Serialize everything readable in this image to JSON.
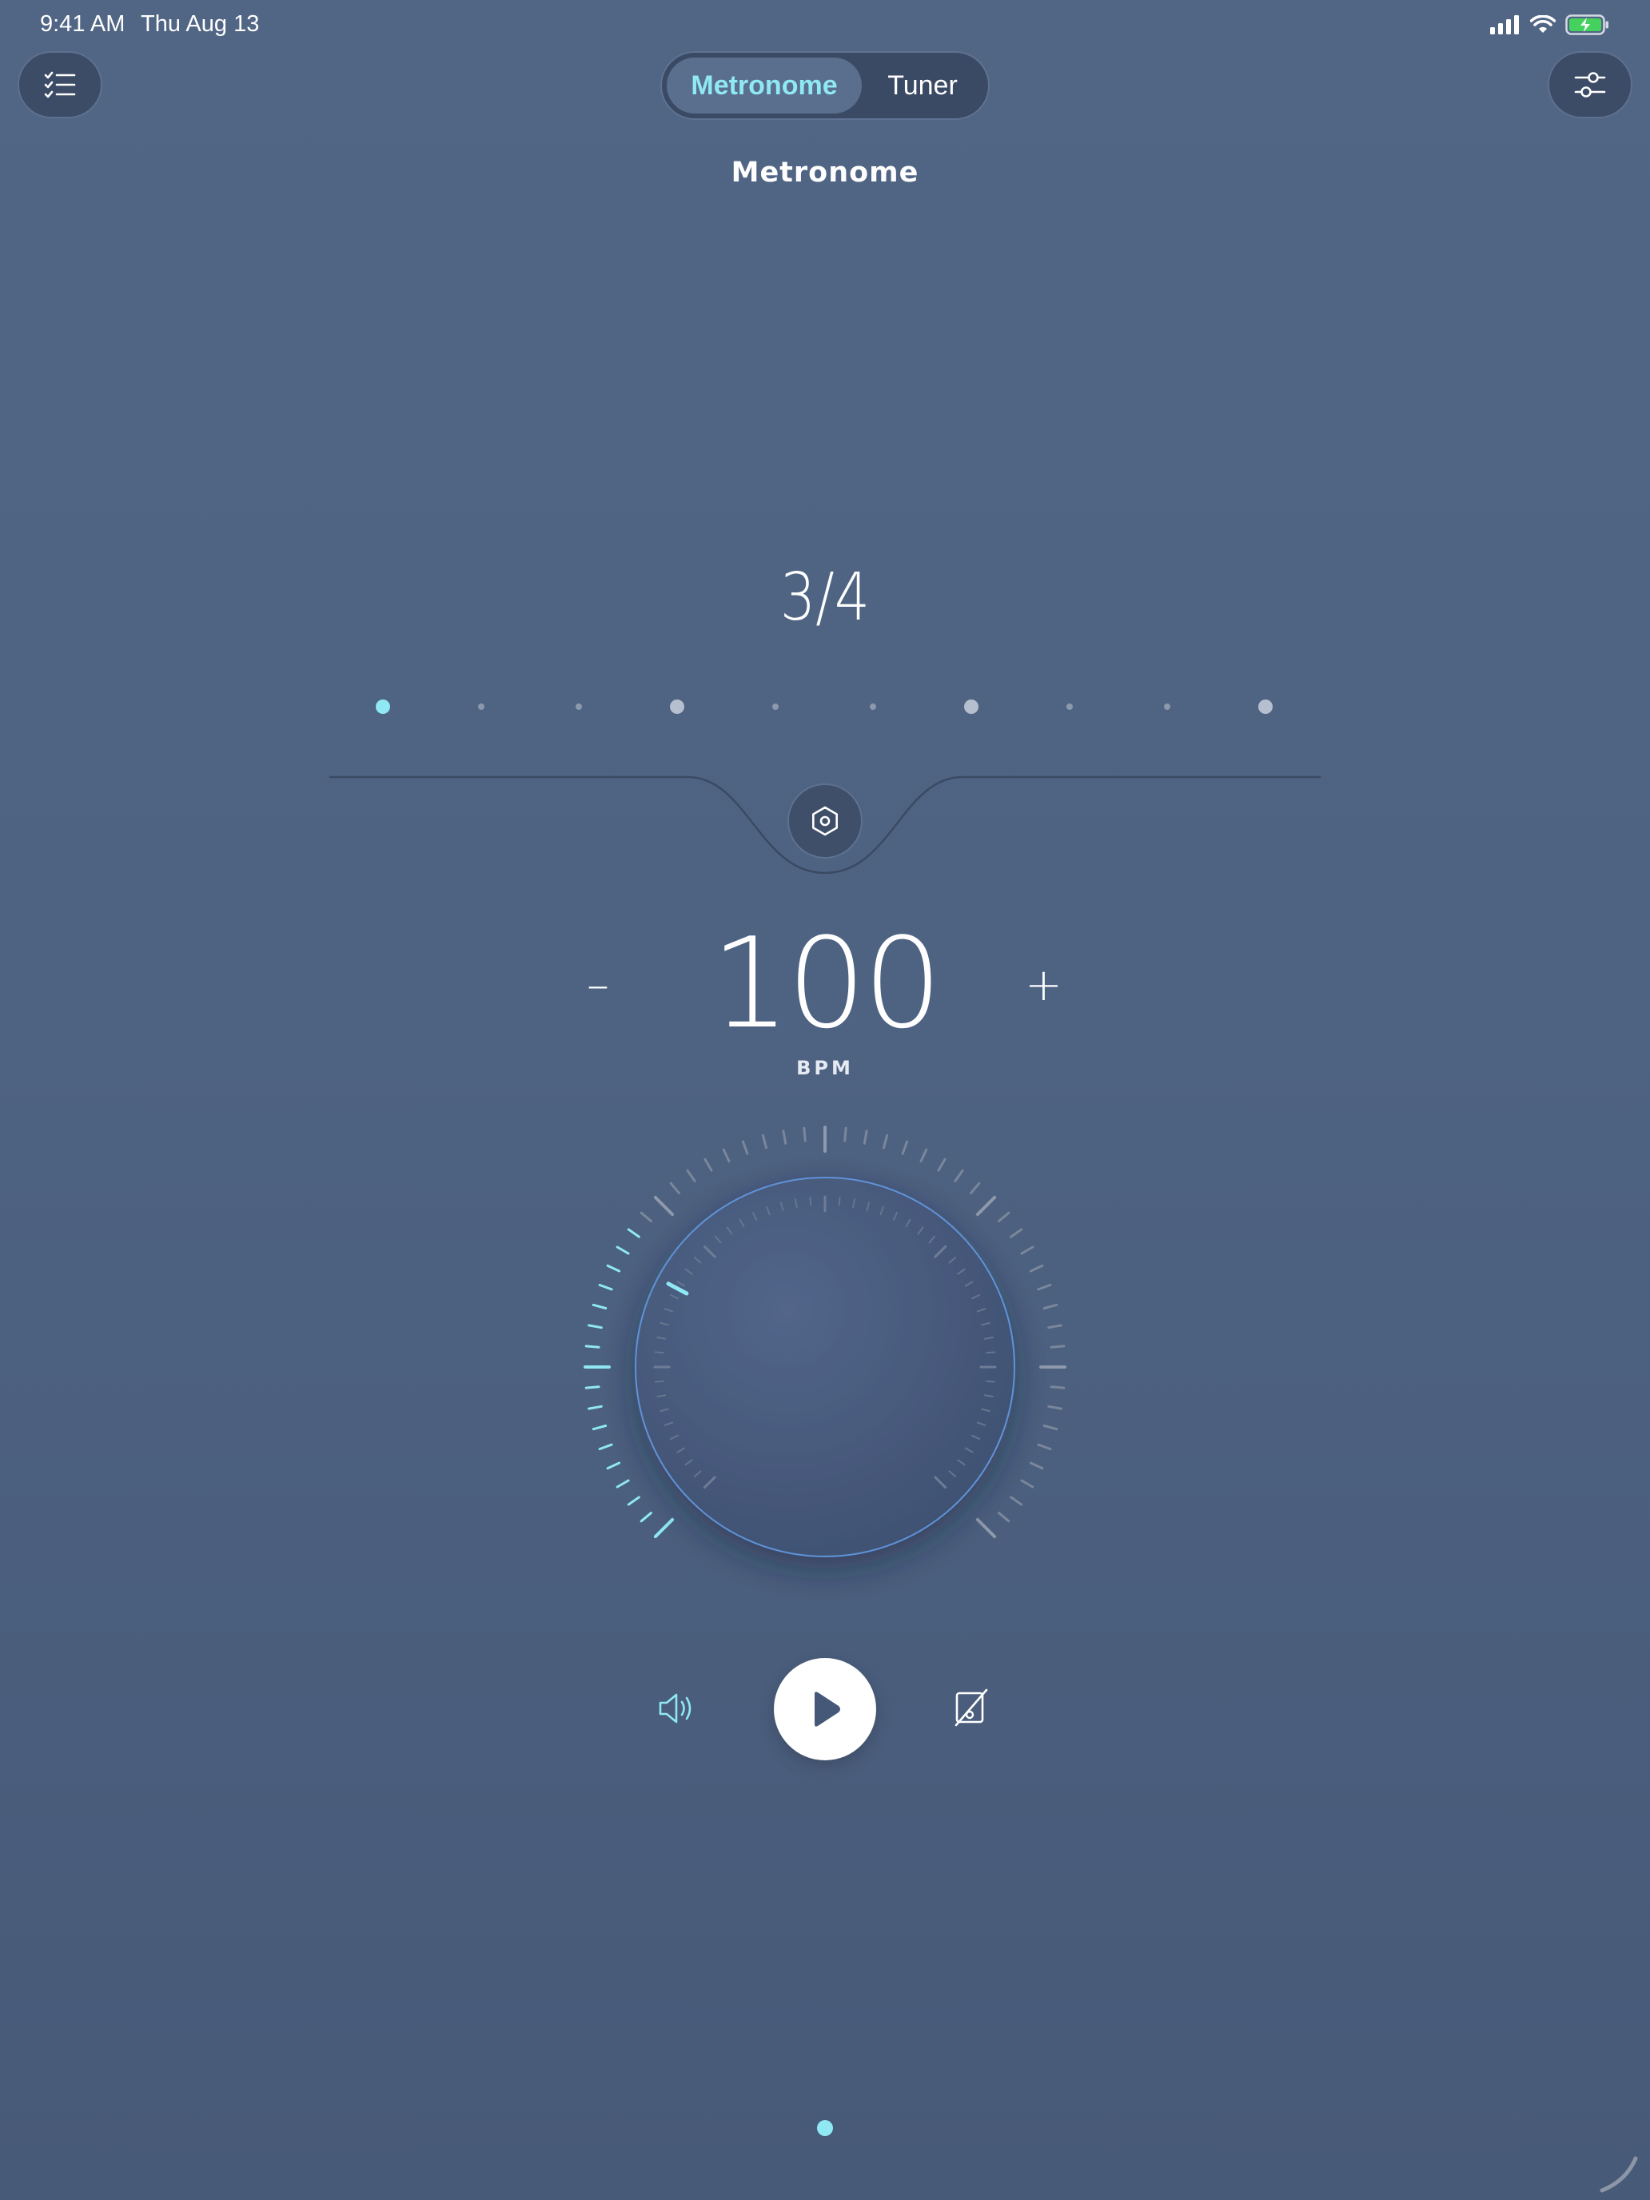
{
  "status_bar": {
    "time": "9:41 AM",
    "date": "Thu Aug 13",
    "icons": [
      "cellular-signal-icon",
      "wifi-icon",
      "battery-charging-icon"
    ]
  },
  "toolbar": {
    "left_icon": "checklist-icon",
    "right_icon": "sliders-icon"
  },
  "tabs": [
    {
      "label": "Metronome",
      "active": true
    },
    {
      "label": "Tuner",
      "active": false
    }
  ],
  "page": {
    "title": "Metronome"
  },
  "metronome": {
    "time_signature": "3/4",
    "beats_shown": 10,
    "accent_beats": [
      1,
      4,
      7,
      10
    ],
    "current_beat": 1,
    "bpm": "100",
    "bpm_label": "BPM",
    "minus_label": "–",
    "plus_label": "+"
  },
  "controls": {
    "sound_icon": "speaker-icon",
    "play_icon": "play-icon",
    "edit_icon": "edit-disabled-icon"
  },
  "pagination": {
    "pages": 1,
    "current": 1
  },
  "colors": {
    "accent": "#8fe8f4",
    "background": "#516684",
    "button_bg": "#3d4c66"
  }
}
